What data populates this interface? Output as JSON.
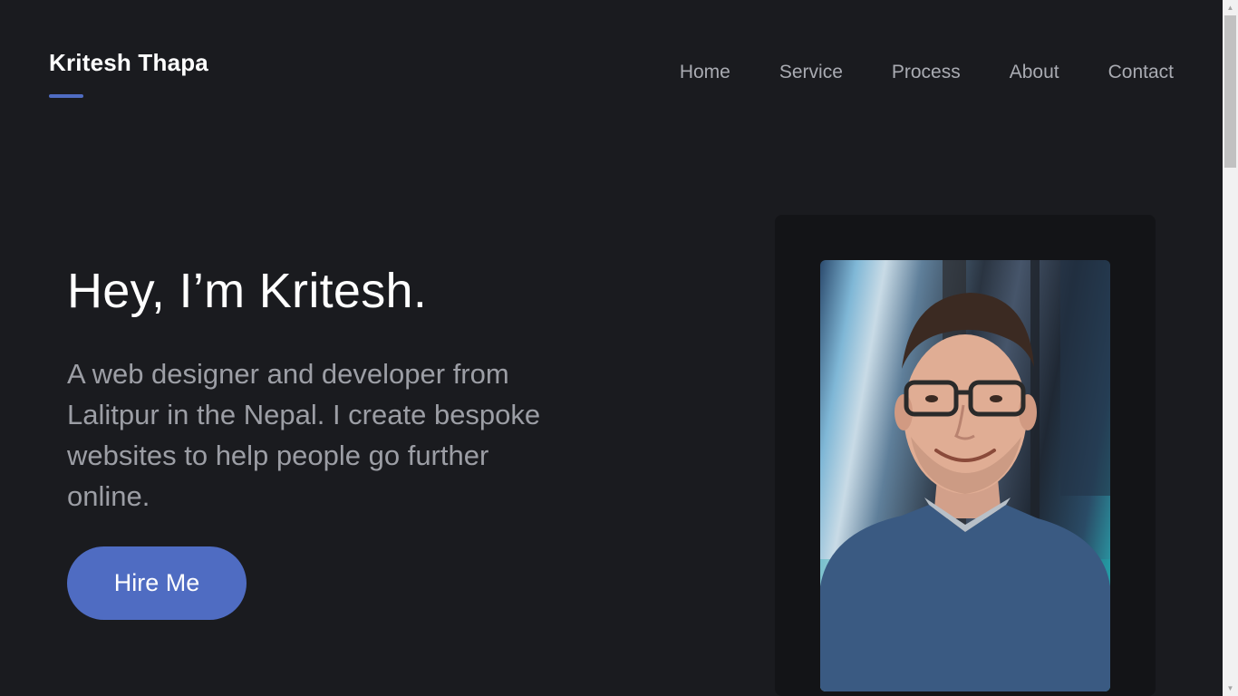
{
  "brand": {
    "name": "Kritesh Thapa"
  },
  "nav": {
    "items": [
      "Home",
      "Service",
      "Process",
      "About",
      "Contact"
    ]
  },
  "hero": {
    "title": "Hey, I’m Kritesh.",
    "description": "A web designer and developer from Lalitpur in the Nepal. I create bespoke websites to help people go further online.",
    "cta_label": "Hire Me"
  },
  "colors": {
    "background": "#1a1b1f",
    "accent": "#4f6cc2",
    "card": "#131417",
    "muted_text": "#9c9ea5"
  },
  "icons": {
    "scroll_up": "▲",
    "scroll_down": "▼"
  }
}
